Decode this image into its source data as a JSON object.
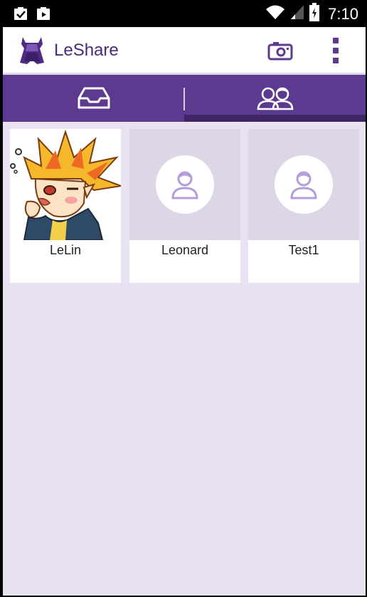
{
  "status_bar": {
    "time": "7:10"
  },
  "app_bar": {
    "title": "LeShare"
  },
  "tabs": [
    {
      "name": "inbox",
      "icon": "inbox-icon",
      "selected": false
    },
    {
      "name": "friends",
      "icon": "friends-icon",
      "selected": true
    }
  ],
  "contacts": [
    {
      "name": "LeLin",
      "has_photo": true
    },
    {
      "name": "Leonard",
      "has_photo": false
    },
    {
      "name": "Test1",
      "has_photo": false
    }
  ],
  "colors": {
    "primary": "#5c3a8f",
    "primary_dark": "#3f2466",
    "background": "#e9e3f1",
    "avatar_placeholder": "#ddd6e6",
    "icon_purple": "#b39ddb"
  }
}
